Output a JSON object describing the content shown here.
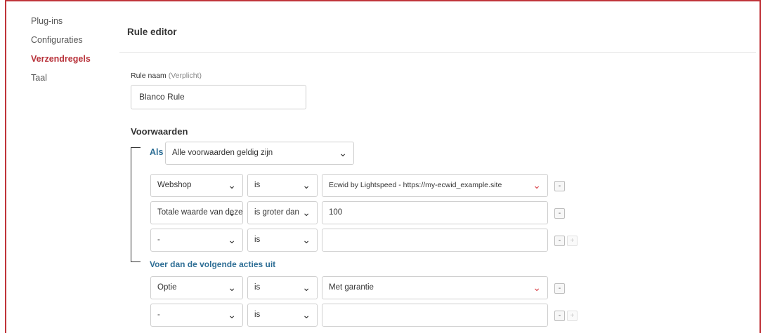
{
  "sidebar": {
    "items": [
      {
        "label": "Plug-ins"
      },
      {
        "label": "Configuraties"
      },
      {
        "label": "Verzendregels"
      },
      {
        "label": "Taal"
      }
    ]
  },
  "editor": {
    "title": "Rule editor",
    "rule_name_label": "Rule naam",
    "rule_name_required": "(Verplicht)",
    "rule_name_value": "Blanco Rule",
    "conditions_heading": "Voorwaarden",
    "if_label": "Als",
    "if_mode": "Alle voorwaarden geldig zijn",
    "conditions": [
      {
        "field": "Webshop",
        "operator": "is",
        "value": "Ecwid by Lightspeed - https://my-ecwid_example.site"
      },
      {
        "field": "Totale waarde van deze",
        "operator": "is groter dan",
        "value": "100"
      },
      {
        "field": "-",
        "operator": "is",
        "value": ""
      }
    ],
    "actions_heading": "Voer dan de volgende acties uit",
    "actions": [
      {
        "field": "Optie",
        "operator": "is",
        "value": "Met garantie"
      },
      {
        "field": "-",
        "operator": "is",
        "value": ""
      }
    ],
    "remove_label": "-",
    "add_label": "+"
  },
  "colors": {
    "accent_red": "#c0343a",
    "link_blue": "#2f6f96"
  }
}
